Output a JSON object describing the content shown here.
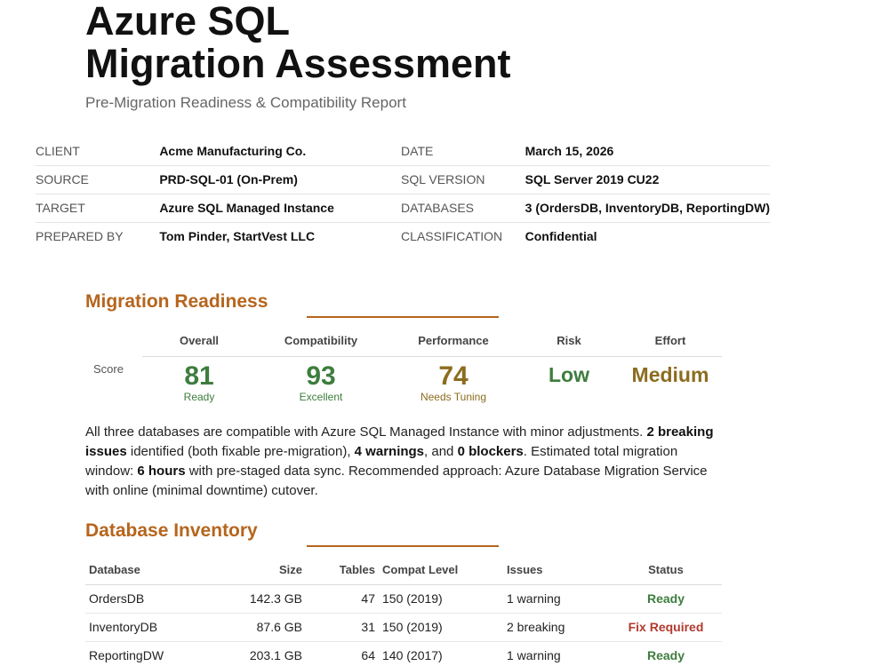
{
  "header": {
    "title_line1": "Azure SQL",
    "title_line2": "Migration Assessment",
    "subtitle": "Pre-Migration Readiness & Compatibility Report"
  },
  "meta": [
    {
      "k1": "CLIENT",
      "v1": "Acme Manufacturing Co.",
      "k2": "DATE",
      "v2": "March 15, 2026"
    },
    {
      "k1": "SOURCE",
      "v1": "PRD-SQL-01 (On-Prem)",
      "k2": "SQL VERSION",
      "v2": "SQL Server 2019 CU22"
    },
    {
      "k1": "TARGET",
      "v1": "Azure SQL Managed Instance",
      "k2": "DATABASES",
      "v2": "3 (OrdersDB, InventoryDB, ReportingDW)"
    },
    {
      "k1": "PREPARED BY",
      "v1": "Tom Pinder, StartVest LLC",
      "k2": "CLASSIFICATION",
      "v2": "Confidential"
    }
  ],
  "readiness": {
    "title": "Migration Readiness",
    "row_label": "Score",
    "headers": [
      "Overall",
      "Compatibility",
      "Performance",
      "Risk",
      "Effort"
    ],
    "overall": {
      "value": "81",
      "sub": "Ready"
    },
    "compatibility": {
      "value": "93",
      "sub": "Excellent"
    },
    "performance": {
      "value": "74",
      "sub": "Needs Tuning"
    },
    "risk": "Low",
    "effort": "Medium",
    "colors": {
      "good": "#3e7d3e",
      "caution": "#8c6d1f"
    }
  },
  "summary": {
    "p1": "All three databases are compatible with Azure SQL Managed Instance with minor adjustments. ",
    "b1": "2 breaking issues",
    "p2": " identified (both fixable pre-migration), ",
    "b2": "4 warnings",
    "p3": ", and ",
    "b3": "0 blockers",
    "p4": ". Estimated total migration window: ",
    "b4": "6 hours",
    "p5": " with pre-staged data sync. Recommended approach: Azure Database Migration Service with online (minimal downtime) cutover."
  },
  "inventory": {
    "title": "Database Inventory",
    "columns": [
      "Database",
      "Size",
      "Tables",
      "Compat Level",
      "Issues",
      "Status"
    ],
    "rows": [
      {
        "name": "OrdersDB",
        "size": "142.3 GB",
        "tables": "47",
        "compat": "150 (2019)",
        "issues": "1 warning",
        "status": "Ready"
      },
      {
        "name": "InventoryDB",
        "size": "87.6 GB",
        "tables": "31",
        "compat": "150 (2019)",
        "issues": "2 breaking",
        "status": "Fix Required"
      },
      {
        "name": "ReportingDW",
        "size": "203.1 GB",
        "tables": "64",
        "compat": "140 (2017)",
        "issues": "1 warning",
        "status": "Ready"
      }
    ],
    "colors": {
      "ready": "#3e7d3e",
      "fix": "#b03a2e"
    }
  },
  "theme": {
    "accent": "#b5651d"
  }
}
